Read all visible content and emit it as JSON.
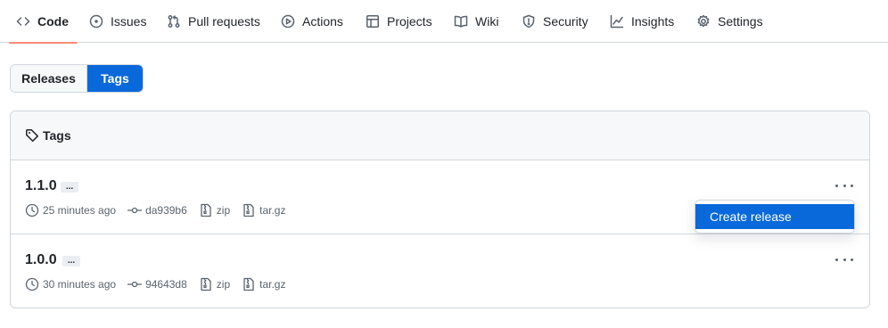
{
  "nav": {
    "items": [
      {
        "label": "Code",
        "icon": "code-icon"
      },
      {
        "label": "Issues",
        "icon": "issue-opened-icon"
      },
      {
        "label": "Pull requests",
        "icon": "git-pull-request-icon"
      },
      {
        "label": "Actions",
        "icon": "play-icon"
      },
      {
        "label": "Projects",
        "icon": "table-icon"
      },
      {
        "label": "Wiki",
        "icon": "book-icon"
      },
      {
        "label": "Security",
        "icon": "shield-icon"
      },
      {
        "label": "Insights",
        "icon": "graph-icon"
      },
      {
        "label": "Settings",
        "icon": "gear-icon"
      }
    ],
    "active": "Code"
  },
  "toggle": {
    "releases_label": "Releases",
    "tags_label": "Tags",
    "selected": "Tags"
  },
  "box": {
    "header_title": "Tags",
    "tags": [
      {
        "name": "1.1.0",
        "ellipsis": "...",
        "time": "25 minutes ago",
        "commit": "da939b6",
        "zip": "zip",
        "targz": "tar.gz"
      },
      {
        "name": "1.0.0",
        "ellipsis": "...",
        "time": "30 minutes ago",
        "commit": "94643d8",
        "zip": "zip",
        "targz": "tar.gz"
      }
    ]
  },
  "menu": {
    "create_release": "Create release"
  },
  "colors": {
    "accent": "#0969da",
    "nav_underline": "#fd8c73",
    "border": "#d0d7de",
    "muted": "#59636e",
    "header_bg": "#f6f8fa"
  }
}
